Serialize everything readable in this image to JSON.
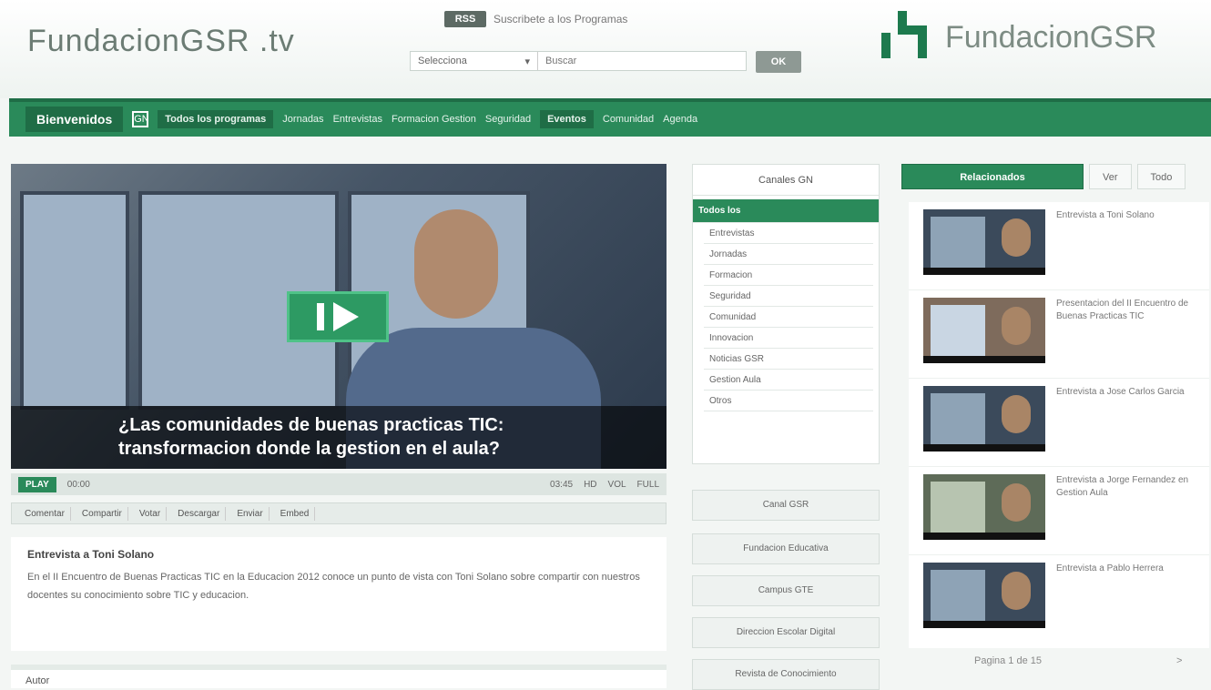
{
  "header": {
    "site_title": "FundacionGSR .tv",
    "rss_label": "RSS",
    "rss_text": "Suscribete a los Programas",
    "search_select": "Selecciona",
    "search_placeholder": "Buscar",
    "search_button": "OK",
    "logo_text": "FundacionGSR"
  },
  "nav": {
    "home": "Bienvenidos",
    "home_icon": "GN",
    "items": [
      "Todos los programas",
      "Jornadas",
      "Entrevistas",
      "Formacion Gestion",
      "Seguridad",
      "Eventos",
      "Comunidad",
      "Agenda"
    ],
    "active_index": 0
  },
  "video": {
    "caption_line1": "¿Las comunidades de buenas practicas TIC:",
    "caption_line2": "transformacion donde la gestion en el aula?",
    "controls": {
      "play": "PLAY",
      "time_current": "00:00",
      "time_total": "03:45",
      "hd": "HD",
      "volume": "VOL",
      "fullscreen": "FULL"
    },
    "toolbar": [
      "Comentar",
      "Compartir",
      "Votar",
      "Descargar",
      "Enviar",
      "Embed"
    ]
  },
  "description": {
    "title": "Entrevista a Toni Solano",
    "text": "En el II Encuentro de Buenas Practicas TIC en la Educacion 2012 conoce un punto de vista con Toni Solano sobre compartir con nuestros docentes su conocimiento sobre TIC y educacion."
  },
  "bottom": {
    "label": "Autor"
  },
  "categories": {
    "header": "Canales GN",
    "items": [
      "Todos los",
      "Entrevistas",
      "Jornadas",
      "Formacion",
      "Seguridad",
      "Comunidad",
      "Innovacion",
      "Noticias GSR",
      "Gestion Aula",
      "Otros"
    ],
    "active_index": 0
  },
  "side_buttons": [
    "Canal GSR",
    "Fundacion Educativa",
    "Campus GTE",
    "Direccion Escolar Digital",
    "Revista de Conocimiento"
  ],
  "tabs": {
    "items": [
      "Relacionados",
      "Ver",
      "Todo"
    ],
    "active_index": 0
  },
  "related": [
    {
      "title": "Entrevista a Toni Solano"
    },
    {
      "title": "Presentacion del II Encuentro de Buenas Practicas TIC"
    },
    {
      "title": "Entrevista a Jose Carlos Garcia"
    },
    {
      "title": "Entrevista a Jorge Fernandez en Gestion Aula"
    },
    {
      "title": "Entrevista a Pablo Herrera"
    }
  ],
  "pager": {
    "label": "Pagina 1 de 15",
    "next": ">"
  },
  "colors": {
    "brand_green": "#2a8a5a",
    "brand_dark": "#1f6d46"
  }
}
